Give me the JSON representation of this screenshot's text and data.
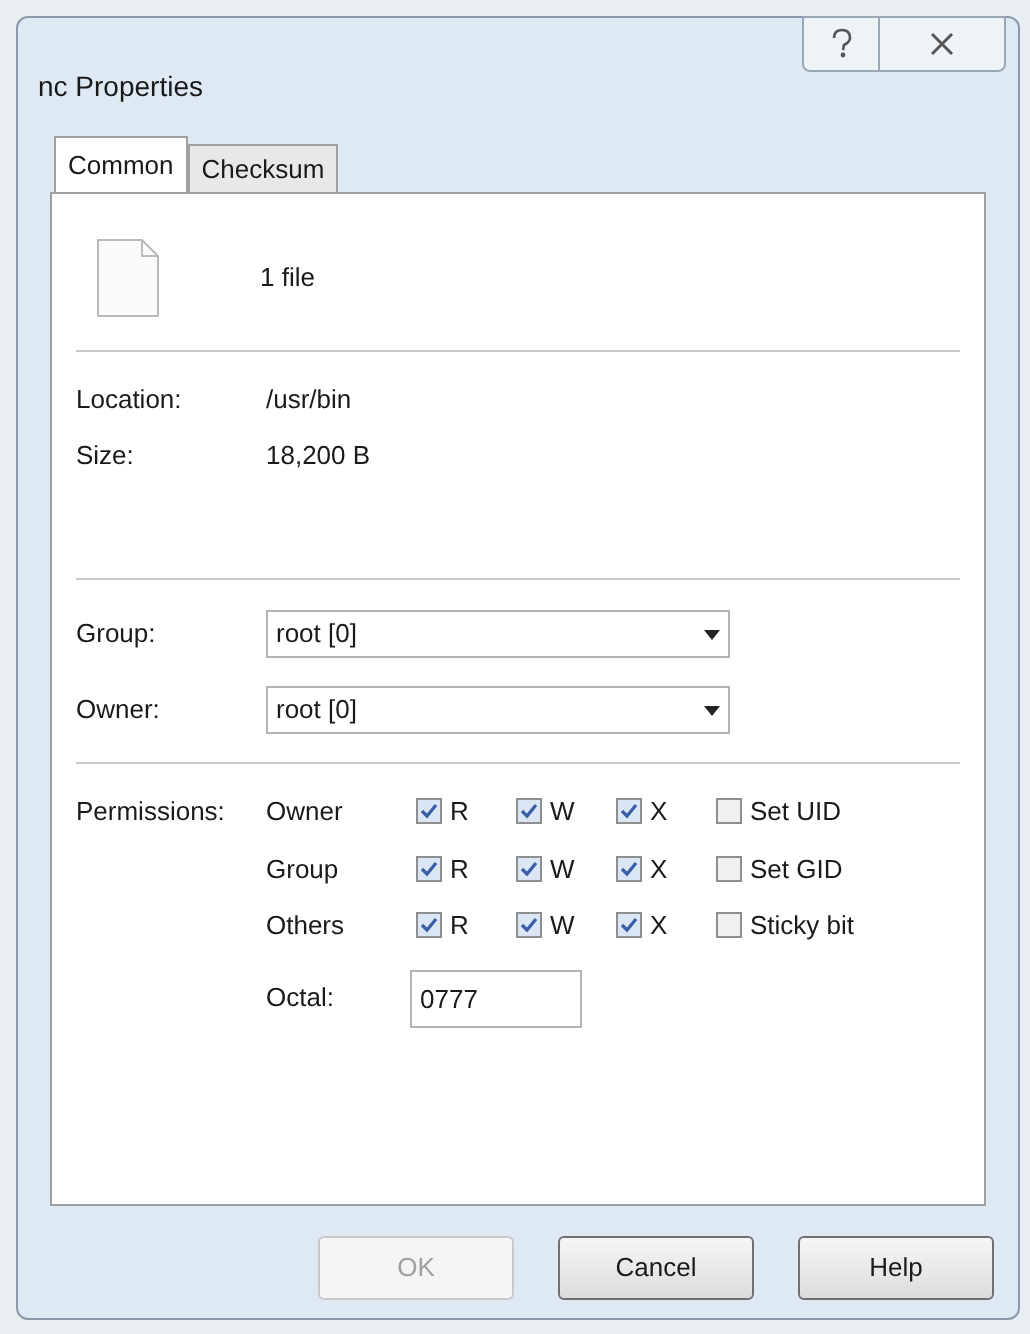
{
  "window": {
    "title": "nc Properties"
  },
  "tabs": [
    {
      "label": "Common",
      "selected": true
    },
    {
      "label": "Checksum",
      "selected": false
    }
  ],
  "summary": {
    "text": "1 file"
  },
  "info": [
    {
      "label": "Location:",
      "value": "/usr/bin"
    },
    {
      "label": "Size:",
      "value": "18,200 B"
    }
  ],
  "ownership": [
    {
      "label": "Group:",
      "value": "root [0]"
    },
    {
      "label": "Owner:",
      "value": "root [0]"
    }
  ],
  "permissions": {
    "label": "Permissions:",
    "rows": [
      {
        "label": "Owner",
        "r": {
          "label": "R",
          "checked": true
        },
        "w": {
          "label": "W",
          "checked": true
        },
        "x": {
          "label": "X",
          "checked": true
        },
        "special": {
          "label": "Set UID",
          "checked": false
        }
      },
      {
        "label": "Group",
        "r": {
          "label": "R",
          "checked": true
        },
        "w": {
          "label": "W",
          "checked": true
        },
        "x": {
          "label": "X",
          "checked": true
        },
        "special": {
          "label": "Set GID",
          "checked": false
        }
      },
      {
        "label": "Others",
        "r": {
          "label": "R",
          "checked": true
        },
        "w": {
          "label": "W",
          "checked": true
        },
        "x": {
          "label": "X",
          "checked": true
        },
        "special": {
          "label": "Sticky bit",
          "checked": false
        }
      }
    ],
    "octal": {
      "label": "Octal:",
      "value": "0777"
    }
  },
  "buttons": [
    {
      "label": "OK",
      "disabled": true
    },
    {
      "label": "Cancel",
      "disabled": false
    },
    {
      "label": "Help",
      "disabled": false
    }
  ]
}
